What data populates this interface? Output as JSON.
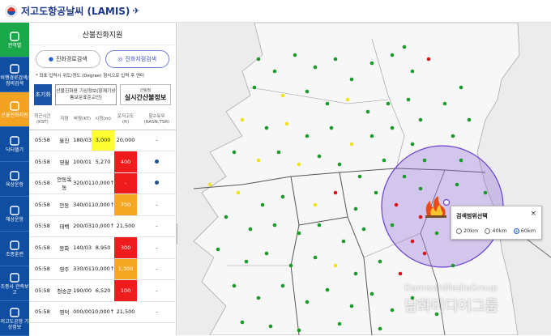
{
  "header": {
    "title": "저고도항공날씨 (LAMIS)"
  },
  "nav": [
    {
      "label": "권역별",
      "icon": "map-region-icon",
      "style": "green"
    },
    {
      "label": "비행경로검색/정비검색",
      "icon": "search-icon",
      "style": ""
    },
    {
      "label": "산불진화지원",
      "icon": "wildfire-icon",
      "style": "active"
    },
    {
      "label": "닥터헬기",
      "icon": "helicopter-icon",
      "style": ""
    },
    {
      "label": "육상운항",
      "icon": "land-ops-icon",
      "style": ""
    },
    {
      "label": "해상운항",
      "icon": "sea-ops-icon",
      "style": ""
    },
    {
      "label": "조종훈련",
      "icon": "training-icon",
      "style": ""
    },
    {
      "label": "조종사 관측보고",
      "icon": "pilot-report-icon",
      "style": ""
    },
    {
      "label": "저고도공항 기상정보",
      "icon": "airport-weather-icon",
      "style": ""
    }
  ],
  "panel": {
    "title": "산불진화지원",
    "tab_route": "진화경로검색",
    "tab_point": "진화지점검색",
    "notice": "* 좌표 입력시 위도/경도 (Degree) 형식으로 입력 후 엔터",
    "reset": "초기화",
    "meteo_button": "산불진화용 기상정보(항재기상통보문표준교안)",
    "forest_small": "산림청",
    "forest_big": "실시간산불정보",
    "columns": [
      "최근시간(KST)",
      "지점",
      "바람(KT)",
      "시정(m)",
      "운저고도(ft)",
      "항수유무(RASN,TSR)"
    ],
    "rows": [
      {
        "time": "05:58",
        "site": "울진",
        "wind": "180/03",
        "vis": "3,000",
        "vis_flag": "yellow",
        "ceil": "20,000",
        "ceil_flag": "",
        "status": "-"
      },
      {
        "time": "05:58",
        "site": "영월",
        "wind": "100/01",
        "vis": "5,270",
        "vis_flag": "",
        "ceil": "400",
        "ceil_flag": "red",
        "status": "dot"
      },
      {
        "time": "05:58",
        "site": "안동옥동",
        "wind": "320/01",
        "vis": "10,000↑",
        "vis_flag": "",
        "ceil": "-",
        "ceil_flag": "red",
        "status": "dot"
      },
      {
        "time": "05:58",
        "site": "안동",
        "wind": "340/01",
        "vis": "10,000↑",
        "vis_flag": "",
        "ceil": "700",
        "ceil_flag": "orange",
        "status": "-"
      },
      {
        "time": "05:58",
        "site": "태백",
        "wind": "200/03",
        "vis": "10,000↑",
        "vis_flag": "",
        "ceil": "21,500",
        "ceil_flag": "",
        "status": "-"
      },
      {
        "time": "05:58",
        "site": "봉화",
        "wind": "140/03",
        "vis": "8,950",
        "vis_flag": "",
        "ceil": "300",
        "ceil_flag": "red",
        "status": "-"
      },
      {
        "time": "05:58",
        "site": "영주",
        "wind": "330/01",
        "vis": "10,000↑",
        "vis_flag": "",
        "ceil": "1,300",
        "ceil_flag": "orange",
        "status": "-"
      },
      {
        "time": "05:58",
        "site": "청송군",
        "wind": "190/00",
        "vis": "6,520",
        "vis_flag": "",
        "ceil": "100",
        "ceil_flag": "red",
        "status": "-"
      },
      {
        "time": "05:58",
        "site": "영덕",
        "wind": "000/00",
        "vis": "10,000↑",
        "vis_flag": "",
        "ceil": "21,500",
        "ceil_flag": "",
        "status": "-"
      }
    ]
  },
  "popup": {
    "title": "검색범위선택",
    "close": "×",
    "options": [
      "20km",
      "40km",
      "60km"
    ],
    "selected": "60km"
  },
  "watermark": {
    "en": "DamwahMediaGroup",
    "ko": "담화미디어그룹"
  },
  "colors": {
    "nav_bg": "#0f4ea0",
    "accent": "#f3a321",
    "radius_circle": "#7b52d6"
  }
}
